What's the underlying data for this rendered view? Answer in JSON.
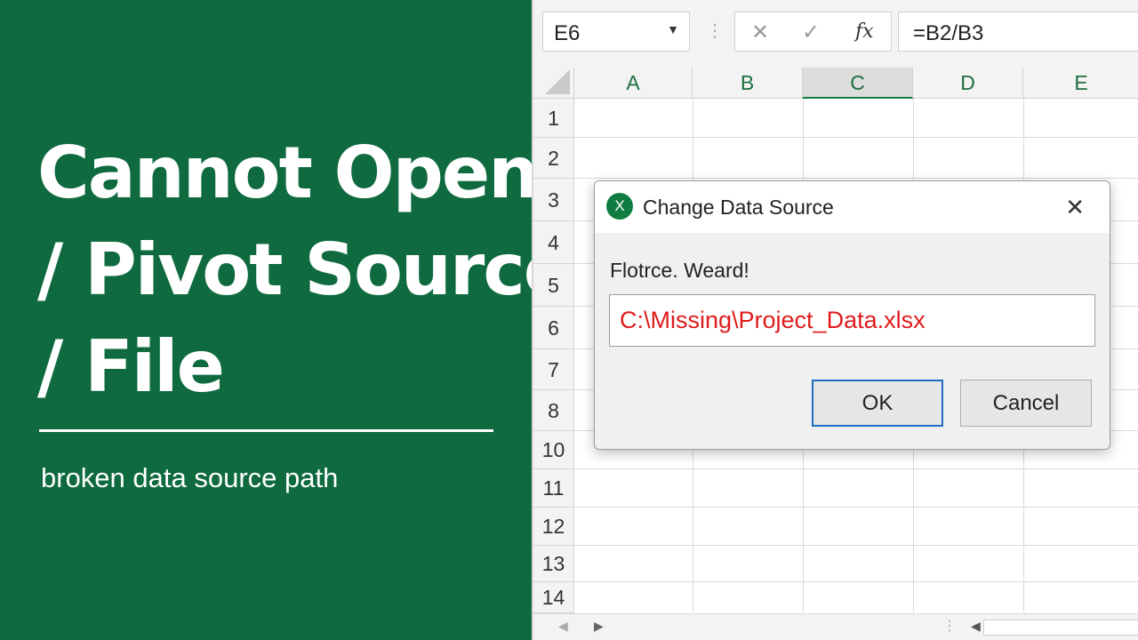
{
  "promo": {
    "title_lines": [
      "Cannot Open",
      "/ Pivot Source",
      "/ File"
    ],
    "subtitle": "broken data source path",
    "background_color": "#0f6b3f"
  },
  "formula_bar": {
    "name_box": "E6",
    "name_box_arrow": "▼",
    "divider": "⋮",
    "cancel_icon": "✕",
    "enter_icon": "✓",
    "fx_label": "fx",
    "formula": "=B2/B3"
  },
  "grid": {
    "columns": [
      "A",
      "B",
      "C",
      "D",
      "E"
    ],
    "selected_column": "C",
    "rows": [
      "1",
      "2",
      "3",
      "4",
      "5",
      "6",
      "7",
      "8",
      "10",
      "11",
      "12",
      "13",
      "14"
    ]
  },
  "dialog": {
    "app_icon_letter": "X",
    "title": "Change Data Source",
    "close_icon": "✕",
    "label": "Flotrce. Weard!",
    "path_value": "C:\\Missing\\Project_Data.xlsx",
    "ok_label": "OK",
    "cancel_label": "Cancel",
    "error_color": "#e01b1b"
  },
  "scrollbar": {
    "left_arrow": "◀",
    "right_arrow": "▶",
    "divider": "⋮"
  }
}
